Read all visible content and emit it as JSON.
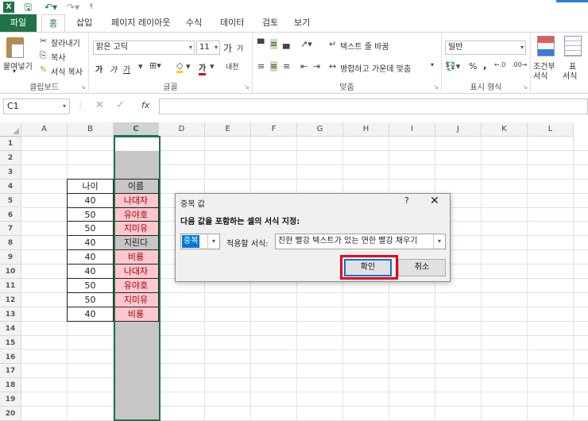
{
  "quick_access": {
    "app_icon": "X",
    "cust": "₹"
  },
  "tabs": [
    "파일",
    "홈",
    "삽입",
    "페이지 레이아웃",
    "수식",
    "데이터",
    "검토",
    "보기"
  ],
  "ribbon": {
    "clipboard": {
      "paste": "붙여넣기",
      "cut": "잘라내기",
      "copy": "복사",
      "format_painter": "서식 복사",
      "label": "클립보드"
    },
    "font": {
      "name": "맑은 고딕",
      "size": "11",
      "grow": "가",
      "shrink": "가",
      "bold": "가",
      "italic": "가",
      "underline": "가",
      "color": "가",
      "phonetic": "내천",
      "label": "글꼴"
    },
    "alignment": {
      "wrap": "텍스트 줄 바꿈",
      "merge": "병합하고 가운데 맞춤",
      "label": "맞춤"
    },
    "number": {
      "format": "일반",
      "percent": "%",
      "comma": ",",
      "label": "표시 형식"
    },
    "styles": {
      "conditional": "조건부",
      "conditional2": "서식",
      "table": "표",
      "table2": "서식"
    }
  },
  "formula_bar": {
    "name_box": "C1",
    "fx": "fx",
    "cancel": "✕",
    "enter": "✓",
    "value": ""
  },
  "columns": [
    "A",
    "B",
    "C",
    "D",
    "E",
    "F",
    "G",
    "H",
    "I",
    "J",
    "K",
    "L"
  ],
  "rows": [
    "1",
    "2",
    "3",
    "4",
    "5",
    "6",
    "7",
    "8",
    "9",
    "10",
    "11",
    "12",
    "13",
    "14",
    "15",
    "16",
    "17",
    "18",
    "19",
    "20"
  ],
  "table": {
    "header_b": "나이",
    "header_c": "이름",
    "rows": [
      {
        "age": "40",
        "name": "나대자",
        "dup": true
      },
      {
        "age": "50",
        "name": "유야호",
        "dup": true
      },
      {
        "age": "50",
        "name": "지미유",
        "dup": true
      },
      {
        "age": "40",
        "name": "지린다",
        "dup": false
      },
      {
        "age": "40",
        "name": "비룡",
        "dup": true
      },
      {
        "age": "40",
        "name": "나대자",
        "dup": true
      },
      {
        "age": "50",
        "name": "유야호",
        "dup": true
      },
      {
        "age": "50",
        "name": "지미유",
        "dup": true
      },
      {
        "age": "40",
        "name": "비룡",
        "dup": true
      }
    ]
  },
  "dialog": {
    "title": "중복 값",
    "help": "?",
    "close": "✕",
    "prompt": "다음 값을 포함하는 셀의 서식 지정:",
    "rule_value": "중복",
    "format_label": "적용할 서식:",
    "format_value": "진한 빨강 텍스트가 있는 연한 빨강 채우기",
    "ok": "확인",
    "cancel": "취소"
  },
  "colors": {
    "excel_green": "#217346",
    "dup_fill": "#ffc7ce",
    "dup_text": "#9c0006",
    "highlight": "#e8001c"
  }
}
